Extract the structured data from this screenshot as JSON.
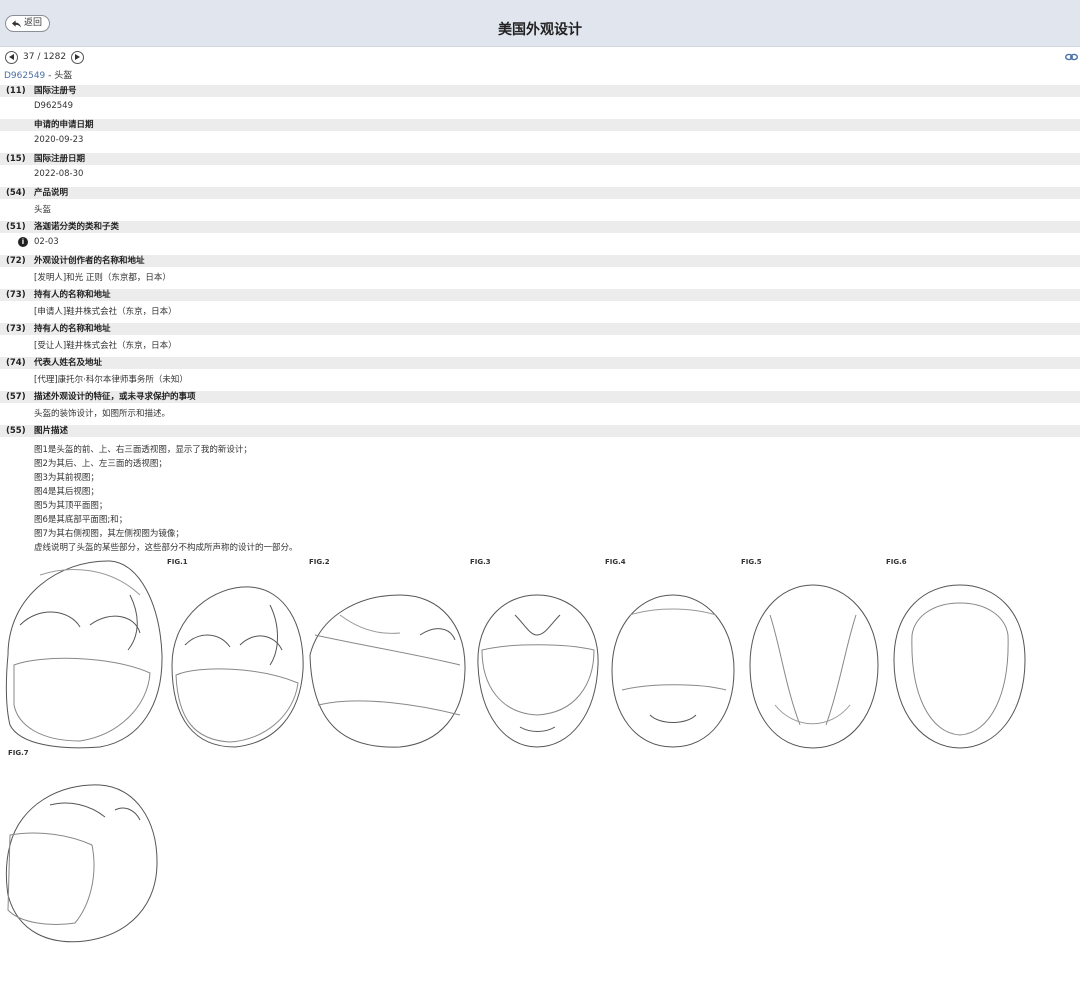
{
  "header": {
    "back_label": "返回",
    "title": "美国外观设计"
  },
  "pager": {
    "current": "37",
    "total": "1282",
    "text": "37 / 1282"
  },
  "record": {
    "reg_no": "D962549",
    "name": "头盔"
  },
  "fields": [
    {
      "code": "(11)",
      "label": "国际注册号",
      "value": "D962549"
    },
    {
      "code": "",
      "label": "申请的申请日期",
      "value": "2020-09-23"
    },
    {
      "code": "(15)",
      "label": "国际注册日期",
      "value": "2022-08-30"
    },
    {
      "code": "(54)",
      "label": "产品说明",
      "value": "头盔"
    },
    {
      "code": "(51)",
      "label": "洛迦诺分类的类和子类",
      "value": "02-03"
    },
    {
      "code": "(72)",
      "label": "外观设计创作者的名称和地址",
      "value": "[发明人]和光 正则（东京都，日本）"
    },
    {
      "code": "(73)",
      "label": "持有人的名称和地址",
      "value": "[申请人]鞋井株式会社（东京，日本）"
    },
    {
      "code": "(73)",
      "label": "持有人的名称和地址",
      "value": "[受让人]鞋井株式会社（东京，日本）"
    },
    {
      "code": "(74)",
      "label": "代表人姓名及地址",
      "value": "[代理]康托尔·科尔本律师事务所（未知）"
    },
    {
      "code": "(57)",
      "label": "描述外观设计的特征，或未寻求保护的事项",
      "value": "头盔的装饰设计，如图所示和描述。"
    },
    {
      "code": "(55)",
      "label": "图片描述",
      "value": ""
    }
  ],
  "figure_descriptions": [
    "图1是头盔的前、上、右三面透视图，显示了我的新设计；",
    "图2为其后、上、左三面的透视图；",
    "图3为其前视图；",
    "图4是其后视图；",
    "图5为其顶平面图；",
    "图6是其底部平面图;和；",
    "图7为其右侧视图，其左侧视图为镜像；",
    "虚线说明了头盔的某些部分，这些部分不构成所声称的设计的一部分。"
  ],
  "figure_labels": [
    "FIG.1",
    "FIG.2",
    "FIG.3",
    "FIG.4",
    "FIG.5",
    "FIG.6",
    "FIG.7"
  ],
  "icons": {
    "back": "back-arrow-icon",
    "prev": "prev-icon",
    "next": "next-icon",
    "link": "link-icon",
    "info": "info-icon"
  }
}
